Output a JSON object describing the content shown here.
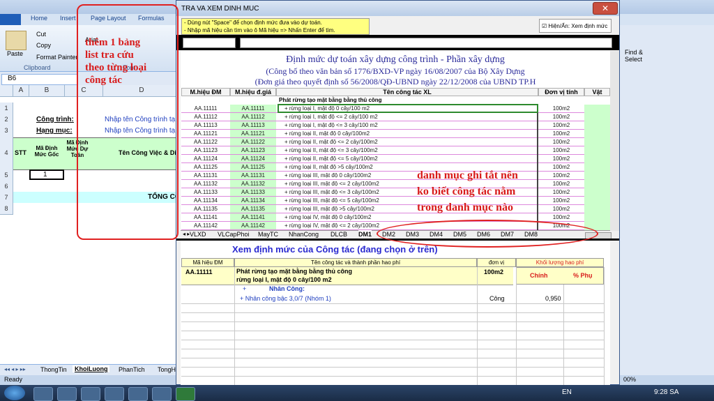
{
  "excel": {
    "ribbon_tabs": [
      "Home",
      "Insert",
      "Page Layout",
      "Formulas"
    ],
    "cut": "Cut",
    "copy": "Copy",
    "format_painter": "Format Painter",
    "paste": "Paste",
    "clipboard": "Clipboard",
    "font": "Font",
    "font_name": "Arial",
    "find_select": "Find &",
    "select": "Select",
    "name_box": "B6",
    "columns": [
      "A",
      "B",
      "C",
      "D"
    ],
    "rows": [
      "1",
      "2",
      "3",
      "4",
      "5",
      "6",
      "7",
      "8"
    ],
    "cong_trinh": "Công trình:",
    "hang_muc": "Hạng mục:",
    "nhap_ct": "Nhập tên Công trình tạ",
    "nhap_hm": "Nhập tên Công trình tạ",
    "stt": "STT",
    "ma_dm_goc": "Mã Định Mức Gốc",
    "ma_dm_du_toan": "Mã Định Mức Dự Toán",
    "ten_cv": "Tên Công Việc & Diễ",
    "row6_val": "1",
    "tong": "TỔNG CỘ",
    "sheet_tabs": [
      "ThongTin",
      "KhoiLuong",
      "PhanTich",
      "TongH"
    ],
    "status": "Ready",
    "zoom": "00%"
  },
  "dialog": {
    "title": "TRA VA XEM DINH MUC",
    "hint1": "- Dùng nút \"Space\" để chọn định mức đưa vào dự toán.",
    "hint2": "- Nhập mã hiệu cần tìm vào ô Mã hiệu => Nhấn Enter để tìm.",
    "toggle": "Hiện/Ẩn: Xem định mức",
    "title1": "Định mức dự toán xây dựng công trình - Phần xây dựng",
    "title2": "(Công bố theo văn bản số 1776/BXD-VP ngày 16/08/2007 của Bộ Xây Dựng",
    "title3": "(Đơn giá theo quyết định số 56/2008/QĐ-UBND ngày 22/12/2008 của UBND TP.H",
    "headers": [
      "M.hiệu ĐM",
      "M.hiệu đ.giá",
      "Tên công tác XL",
      "Đơn vị tính",
      "Vật"
    ],
    "group": "Phát rừng tạo mặt bằng bằng thủ công",
    "rows": [
      [
        "AA.11111",
        "AA.11111",
        "+ rừng loại I, mật độ 0 cây/100 m2",
        "100m2"
      ],
      [
        "AA.11112",
        "AA.11112",
        "+ rừng loại I, mật độ <= 2 cây/100 m2",
        "100m2"
      ],
      [
        "AA.11113",
        "AA.11113",
        "+ rừng loại I, mật độ <= 3 cây/100 m2",
        "100m2"
      ],
      [
        "AA.11121",
        "AA.11121",
        "+ rừng loại II, mật độ 0 cây/100m2",
        "100m2"
      ],
      [
        "AA.11122",
        "AA.11122",
        "+ rừng loại II, mật độ <= 2 cây/100m2",
        "100m2"
      ],
      [
        "AA.11123",
        "AA.11123",
        "+ rừng loại II, mật độ <= 3 cây/100m2",
        "100m2"
      ],
      [
        "AA.11124",
        "AA.11124",
        "+ rừng loại II, mật độ <= 5 cây/100m2",
        "100m2"
      ],
      [
        "AA.11125",
        "AA.11125",
        "+ rừng loại II, mật độ >5 cây/100m2",
        "100m2"
      ],
      [
        "AA.11131",
        "AA.11131",
        "+ rừng loại III, mật độ 0 cây/100m2",
        "100m2"
      ],
      [
        "AA.11132",
        "AA.11132",
        "+ rừng loại III, mật độ <= 2 cây/100m2",
        "100m2"
      ],
      [
        "AA.11133",
        "AA.11133",
        "+ rừng loại III, mật độ <= 3 cây/100m2",
        "100m2"
      ],
      [
        "AA.11134",
        "AA.11134",
        "+ rừng loại III, mật độ <= 5 cây/100m2",
        "100m2"
      ],
      [
        "AA.11135",
        "AA.11135",
        "+ rừng loại III, mật độ >5 cây/100m2",
        "100m2"
      ],
      [
        "AA.11141",
        "AA.11141",
        "+ rừng loại IV, mật độ 0 cây/100m2",
        "100m2"
      ],
      [
        "AA.11142",
        "AA.11142",
        "+ rừng loại IV, mật độ <= 2 cây/100m2",
        "100m2"
      ]
    ],
    "sheet_tabs": [
      "VLXD",
      "VLCapPhoi",
      "MayTC",
      "NhanCong",
      "DLCB",
      "DM1",
      "DM2",
      "DM3",
      "DM4",
      "DM5",
      "DM6",
      "DM7",
      "DM8"
    ],
    "view_title": "Xem định mức của Công tác (đang chọn ở trên)",
    "view_headers": [
      "Mã hiệu ĐM",
      "Tên công tác và thành phần hao phí",
      "đơn vị",
      "Khối lượng hao phí"
    ],
    "chinh": "Chính",
    "phu": "% Phụ",
    "sel_code": "AA.11111",
    "sel_name1": "Phát rừng tạo mặt bằng bằng thủ công",
    "sel_name2": "rừng loại I, mật độ 0 cây/100 m2",
    "sel_unit": "100m2",
    "nc_plus": "+",
    "nc_label": "Nhân Công:",
    "nc_item": "+ Nhân công bậc 3,0/7 (Nhóm 1)",
    "nc_unit": "Công",
    "nc_val": "0,950"
  },
  "annotations": {
    "left": [
      "thêm 1 bảng",
      "list tra cứu",
      "theo từng loại",
      "công tác"
    ],
    "right": [
      "danh mục ghi tắt nên",
      "ko biết công tác nằm",
      "trong danh mục nào"
    ]
  },
  "taskbar": {
    "lang": "EN",
    "time": "9:28 SA"
  },
  "colors": {
    "annotation": "#d81b1b",
    "title_blue": "#2a2a9a",
    "hint_bg": "#ffff80"
  }
}
